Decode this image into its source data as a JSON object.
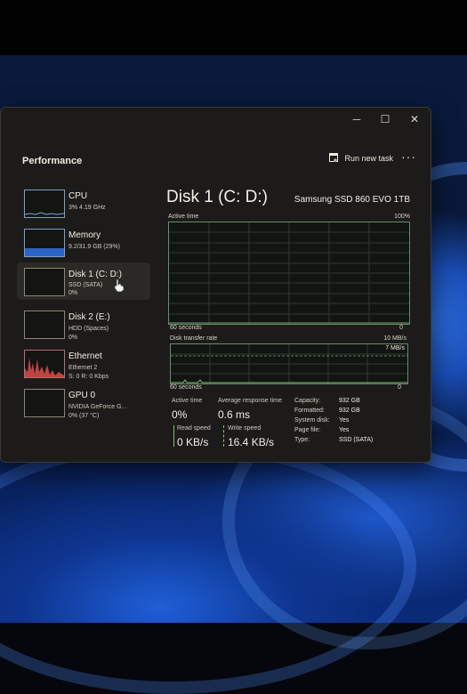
{
  "window": {
    "minimize_icon": "─",
    "maximize_icon": "☐",
    "close_icon": "✕"
  },
  "header": {
    "title": "Performance",
    "run_new_task": "Run new task",
    "more": "···"
  },
  "sidebar": {
    "items": [
      {
        "title": "CPU",
        "sub1": "3%  4.19 GHz",
        "sub2": ""
      },
      {
        "title": "Memory",
        "sub1": "9.2/31.9 GB (29%)",
        "sub2": ""
      },
      {
        "title": "Disk 1 (C: D:)",
        "sub1": "SSD (SATA)",
        "sub2": "0%"
      },
      {
        "title": "Disk 2 (E:)",
        "sub1": "HDD (Spaces)",
        "sub2": "0%"
      },
      {
        "title": "Ethernet",
        "sub1": "Ethernet 2",
        "sub2": "S: 0  R: 0 Kbps"
      },
      {
        "title": "GPU 0",
        "sub1": "NVIDIA GeForce G...",
        "sub2": "0%  (37 °C)"
      }
    ]
  },
  "main": {
    "title": "Disk 1 (C: D:)",
    "model": "Samsung SSD 860 EVO 1TB",
    "active_time_graph": {
      "label": "Active time",
      "max": "100%",
      "time_span": "60 seconds",
      "min": "0"
    },
    "transfer_graph": {
      "label": "Disk transfer rate",
      "max": "10 MB/s",
      "marker": "7 MB/s",
      "time_span": "60 seconds",
      "min": "0"
    },
    "stats": {
      "active_time_label": "Active time",
      "active_time_value": "0%",
      "avg_response_label": "Average response time",
      "avg_response_value": "0.6 ms",
      "read_speed_label": "Read speed",
      "read_speed_value": "0 KB/s",
      "write_speed_label": "Write speed",
      "write_speed_value": "16.4 KB/s"
    },
    "properties": [
      {
        "key": "Capacity:",
        "value": "932 GB"
      },
      {
        "key": "Formatted:",
        "value": "932 GB"
      },
      {
        "key": "System disk:",
        "value": "Yes"
      },
      {
        "key": "Page file:",
        "value": "Yes"
      },
      {
        "key": "Type:",
        "value": "SSD (SATA)"
      }
    ]
  },
  "colors": {
    "graph_border": "#6a8a6a",
    "write_indicator": "#7fc06e",
    "memory_fill": "#2b64c8",
    "ethernet_fill": "#e05050"
  }
}
